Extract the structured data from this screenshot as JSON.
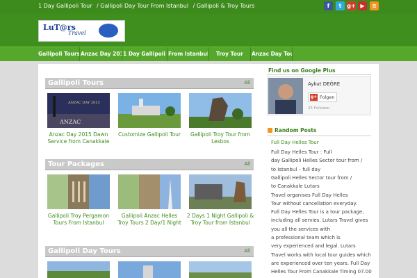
{
  "topbar": {
    "links": [
      "1 Day Gallipoli Tour",
      "/ Gallipoli Day Tour From Istanbul",
      "/ Gallipoli & Troy Tours"
    ],
    "social": [
      {
        "name": "facebook-icon",
        "glyph": "f",
        "color": "#3b5998"
      },
      {
        "name": "twitter-icon",
        "glyph": "t",
        "color": "#30a9de"
      },
      {
        "name": "google-plus-icon",
        "glyph": "g+",
        "color": "#d23e2b"
      },
      {
        "name": "youtube-icon",
        "glyph": "▶",
        "color": "#c4302b"
      },
      {
        "name": "rss-icon",
        "glyph": "≋",
        "color": "#f29322"
      }
    ]
  },
  "logo": {
    "main": "LuT@rs",
    "sub": "Travel"
  },
  "nav": [
    "Gallipoli Tours",
    "Anzac Day 2015",
    "1 Day Gallipoli Tour",
    "From Istanbul",
    "Troy Tour",
    "Anzac Day Tours"
  ],
  "sections": [
    {
      "title": "Gallipoli Tours",
      "all": "All",
      "items": [
        "Anzac Day 2015 Dawn Service from Canakkale",
        "Customize Gallipoli Tour",
        "Gallipoli Troy Tour from Lesbos"
      ]
    },
    {
      "title": "Tour Packages",
      "all": "All",
      "items": [
        "Gallipoli  Troy Pergamon Tours From Istanbul",
        "Gallipoli Anzac Helles Troy Tours 2 Day/1 Night",
        "2 Days 1 Night Gallipoli & Troy Tour from Istanbul"
      ]
    },
    {
      "title": "Gallipoli Day Tours",
      "all": "All",
      "items": []
    }
  ],
  "thumbs": {
    "anzac_label": "ANZAC DAY 2015",
    "anzac_word": "ANZAC"
  },
  "sidebar": {
    "gplus_title": "Find us on Google Plus",
    "gplus_name": "Aykut DEĞRE",
    "gplus_follow": "Folgen",
    "gplus_followers": "25 Follower",
    "random_title": "Random Posts",
    "random_link": "Full Day Helles Tour",
    "random_lines": [
      "Full Day Helles Tour : Full",
      "day Gallipoli Helles Sector tour from /",
      "to Istanbul – full day",
      "Gallipoli Helles Sector tour from /",
      "to Canakkale Lutars",
      "Travel organises Full Day Helles",
      "Tour without cancellation everyday.",
      "Full Day Helles Tour is a tour package,",
      "including all servies. Lutars Travel gives",
      "you all the services with",
      "a professional team which is",
      "very experienced and legal. Lutars",
      "Travel works with local tour guides which",
      "are experienced over ten years. Full Day",
      "Helles Tour From Canakkale Timing 07.00"
    ]
  }
}
